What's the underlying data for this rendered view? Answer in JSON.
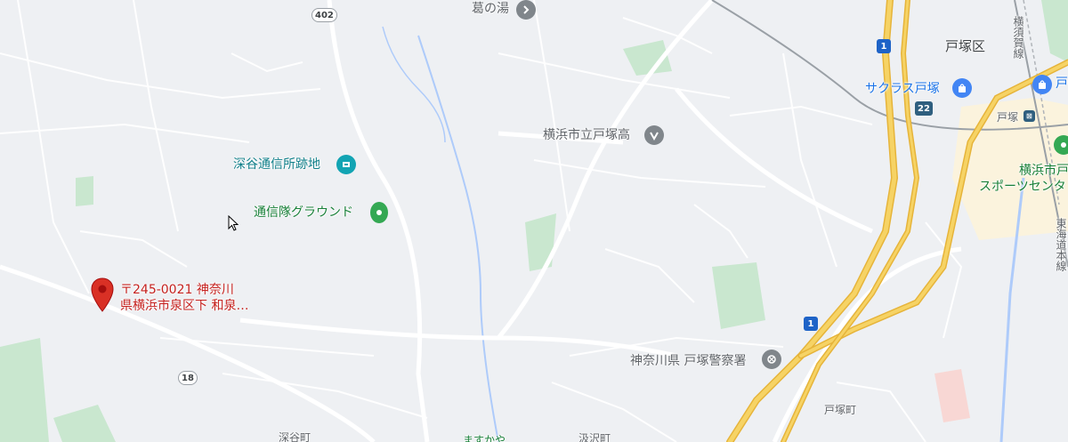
{
  "map": {
    "labels": {
      "kuzu_no_yu": "葛の湯",
      "fukaya_tsushin": "深谷通信所跡地",
      "tsushintai_ground": "通信隊グラウンド",
      "totsuka_high": "横浜市立戸塚高",
      "sakuras_totsuka": "サクラス戸塚",
      "totsuka_ward": "戸塚区",
      "totsuka_station": "戸塚",
      "totsuka_station_right": "戸",
      "sports_center_line1": "横浜市戸",
      "sports_center_line2": "スポーツセンタ",
      "police": "神奈川県 戸塚警察署",
      "totsuka_cho": "戸塚町",
      "fukaya_cho": "深谷町",
      "bottom_partial1": "ますかや",
      "bottom_partial2": "汲沢町",
      "yokosuka_line": "横須賀線",
      "tokaido_line": "東海道本線"
    },
    "selected_place": {
      "line1": "〒245-0021 神奈川",
      "line2": "県横浜市泉区下 和泉…"
    },
    "routes": {
      "r1_top": "1",
      "r1_bottom": "1",
      "r22": "22",
      "r402": "402",
      "r18": "18"
    },
    "colors": {
      "background": "#eef0f3",
      "road": "#ffffff",
      "highway": "#f6d365",
      "park": "#c9e7cf",
      "water": "#aecbfa",
      "pin_red": "#d93025"
    }
  }
}
